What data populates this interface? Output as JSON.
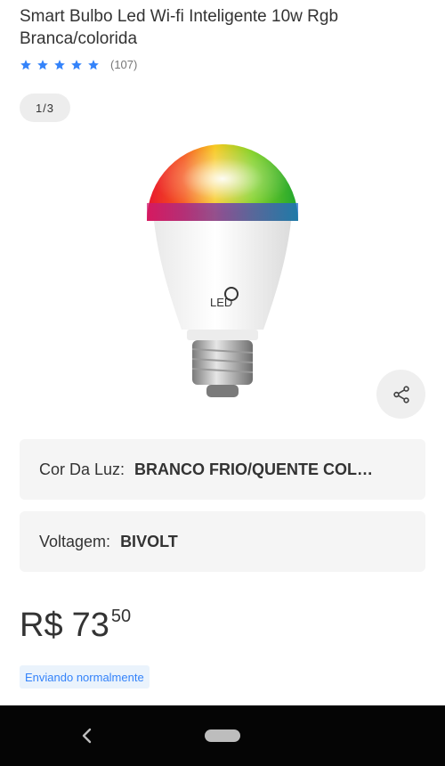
{
  "product": {
    "title": "Smart Bulbo Led Wi-fi Inteligente 10w Rgb Branca/colorida",
    "rating_count": "(107)",
    "rating": 5,
    "image_counter": "1/3",
    "image_logo": "LED"
  },
  "variations": {
    "color": {
      "label": "Cor Da Luz:",
      "value": "BRANCO FRIO/QUENTE COLORIDA"
    },
    "voltage": {
      "label": "Voltagem:",
      "value": "BIVOLT"
    }
  },
  "price": {
    "currency": "R$",
    "whole": "73",
    "cents": "50"
  },
  "shipping": {
    "badge": "Enviando normalmente"
  },
  "colors": {
    "star": "#3483fa",
    "accent_blue": "#3483fa",
    "badge_bg": "#eaf3fc"
  },
  "icons": {
    "share": "share-icon",
    "star": "star-icon",
    "back": "back-icon",
    "home": "home-pill"
  }
}
